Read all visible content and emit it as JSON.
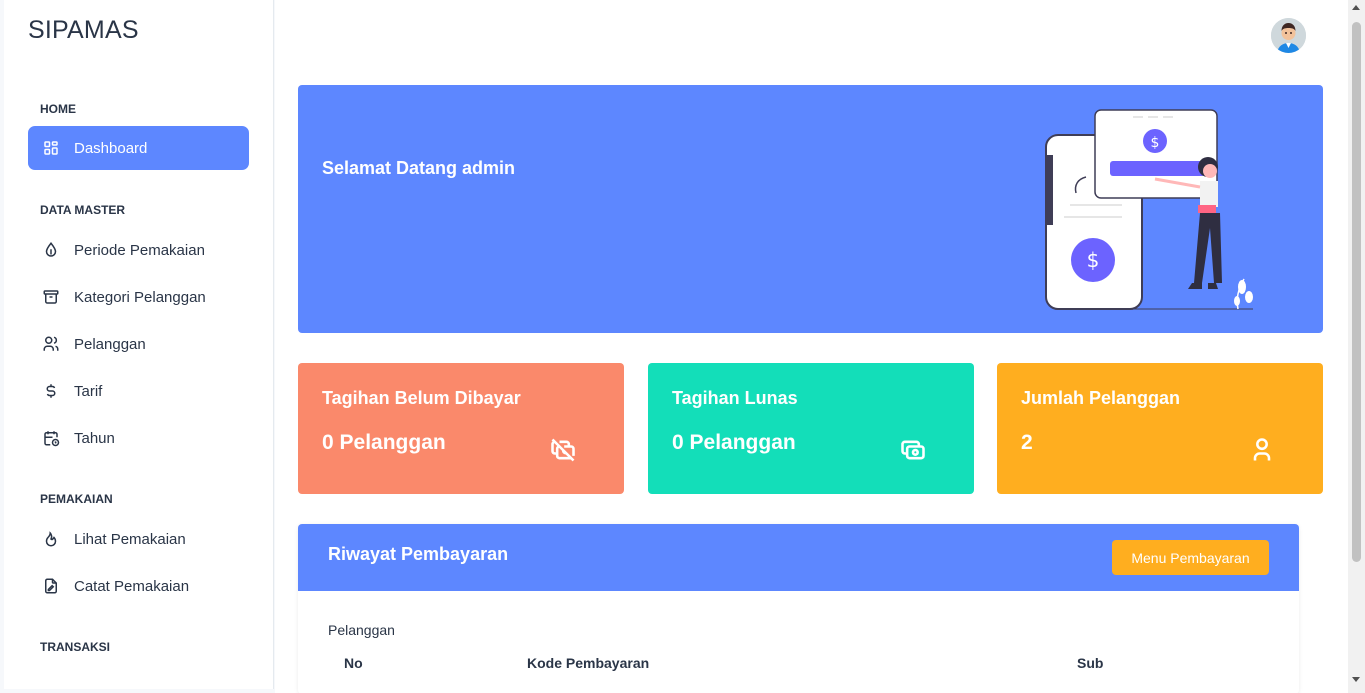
{
  "brand": "SIPAMAS",
  "sidebar": {
    "sections": [
      "HOME",
      "DATA MASTER",
      "PEMAKAIAN",
      "TRANSAKSI"
    ],
    "items": [
      {
        "label": "Dashboard",
        "icon": "dashboard-icon"
      },
      {
        "label": "Periode Pemakaian",
        "icon": "droplet-icon"
      },
      {
        "label": "Kategori Pelanggan",
        "icon": "archive-icon"
      },
      {
        "label": "Pelanggan",
        "icon": "users-icon"
      },
      {
        "label": "Tarif",
        "icon": "dollar-icon"
      },
      {
        "label": "Tahun",
        "icon": "calendar-icon"
      },
      {
        "label": "Lihat Pemakaian",
        "icon": "flame-icon"
      },
      {
        "label": "Catat Pemakaian",
        "icon": "file-edit-icon"
      }
    ]
  },
  "welcome": {
    "text": "Selamat Datang admin"
  },
  "cards": [
    {
      "title": "Tagihan Belum Dibayar",
      "value": "0 Pelanggan",
      "icon": "cash-off-icon",
      "color": "#fa896b"
    },
    {
      "title": "Tagihan Lunas",
      "value": "0 Pelanggan",
      "icon": "cash-icon",
      "color": "#13deb9"
    },
    {
      "title": "Jumlah Pelanggan",
      "value": "2",
      "icon": "user-icon",
      "color": "#ffae1f"
    }
  ],
  "history": {
    "title": "Riwayat Pembayaran",
    "button": "Menu Pembayaran",
    "label": "Pelanggan",
    "columns": [
      "No",
      "Kode Pembayaran",
      "Sub"
    ]
  },
  "colors": {
    "primary": "#5d87ff",
    "warning": "#ffae1f"
  }
}
